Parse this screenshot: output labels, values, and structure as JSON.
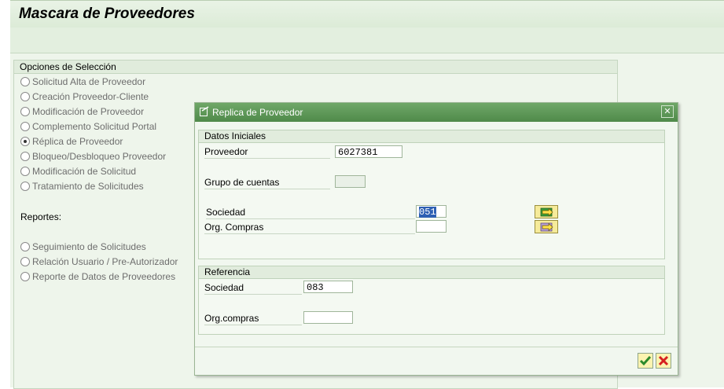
{
  "header": {
    "title": "Mascara de Proveedores"
  },
  "options": {
    "heading": "Opciones de Selección",
    "items": [
      {
        "label": "Solicitud Alta de Proveedor",
        "selected": false
      },
      {
        "label": "Creación Proveedor-Cliente",
        "selected": false
      },
      {
        "label": "Modificación de Proveedor",
        "selected": false
      },
      {
        "label": "Complemento Solicitud Portal",
        "selected": false
      },
      {
        "label": "Réplica de Proveedor",
        "selected": true
      },
      {
        "label": "Bloqueo/Desbloqueo Proveedor",
        "selected": false
      },
      {
        "label": "Modificación de Solicitud",
        "selected": false
      },
      {
        "label": "Tratamiento de Solicitudes",
        "selected": false
      }
    ],
    "reports_label": "Reportes:",
    "reports": [
      {
        "label": "Seguimiento de Solicitudes",
        "selected": false
      },
      {
        "label": "Relación Usuario / Pre-Autorizador",
        "selected": false
      },
      {
        "label": "Reporte de Datos de Proveedores",
        "selected": false
      }
    ]
  },
  "dialog": {
    "title": "Replica de Proveedor",
    "close_icon": "close-icon",
    "initial": {
      "heading": "Datos Iniciales",
      "proveedor_label": "Proveedor",
      "proveedor_value": "6027381",
      "grupo_label": "Grupo de cuentas",
      "grupo_value": "",
      "sociedad_label": "Sociedad",
      "sociedad_value": "051",
      "org_label": "Org. Compras",
      "org_value": ""
    },
    "reference": {
      "heading": "Referencia",
      "sociedad_label": "Sociedad",
      "sociedad_value": "083",
      "org_label": "Org.compras",
      "org_value": ""
    },
    "ok_icon": "checkmark-icon",
    "cancel_icon": "cancel-x-icon"
  }
}
